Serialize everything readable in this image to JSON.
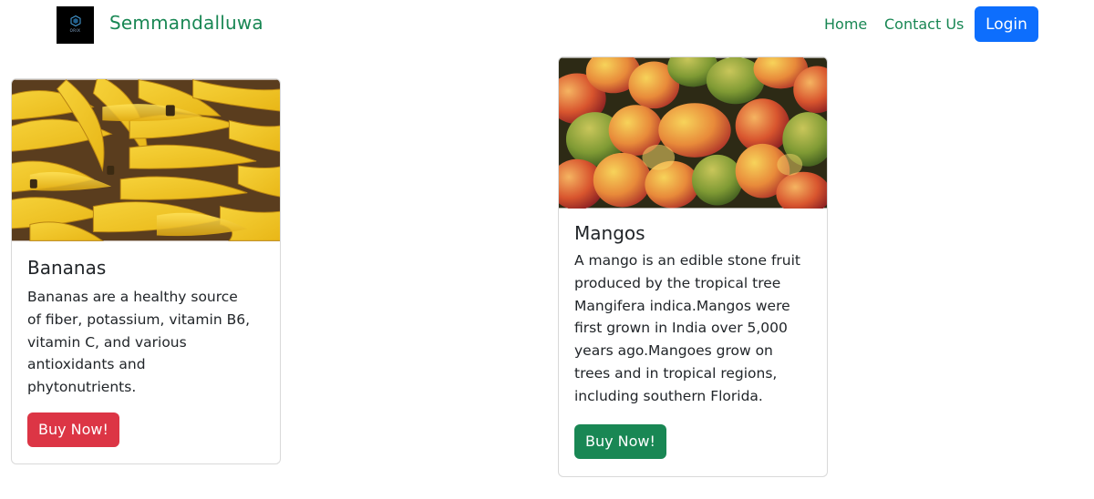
{
  "brand": {
    "logo_text": "ORIX",
    "name": "Semmandalluwa"
  },
  "nav": {
    "home": "Home",
    "contact": "Contact Us",
    "login": "Login"
  },
  "colors": {
    "brand_green": "#198754",
    "primary_blue": "#0d6efd",
    "danger_red": "#dc3545"
  },
  "cards": [
    {
      "image": "bananas-photo",
      "title": "Bananas",
      "text_lines": [
        "Bananas are a healthy source",
        "of fiber, potassium, vitamin B6,",
        "vitamin C, and various",
        "antioxidants and",
        "phytonutrients."
      ],
      "button": "Buy Now!"
    },
    {
      "image": "mangos-photo",
      "title": "Mangos",
      "text_lines": [
        "A mango is an edible stone fruit",
        "produced by the tropical tree",
        "Mangifera indica.Mangos were",
        "first grown in India over 5,000",
        "years ago.Mangoes grow on",
        "trees and in tropical regions,",
        "including southern Florida."
      ],
      "button": "Buy Now!"
    }
  ]
}
